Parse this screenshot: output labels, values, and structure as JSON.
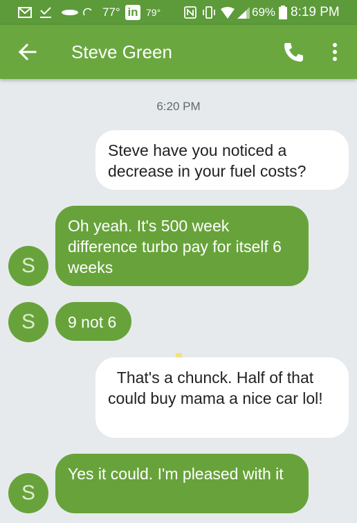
{
  "status_bar": {
    "temp1": "77°",
    "temp2": "79°",
    "linkedin": "in",
    "battery": "69%",
    "time": "8:19 PM"
  },
  "header": {
    "title": "Steve Green",
    "back_icon": "arrow-left-icon",
    "call_icon": "phone-icon",
    "menu_icon": "more-vert-icon"
  },
  "thread": {
    "timestamp": "6:20 PM",
    "messages": [
      {
        "direction": "outgoing",
        "text": "Steve have you noticed a decrease in your fuel costs?"
      },
      {
        "direction": "incoming",
        "avatar": "S",
        "text": "Oh yeah.  It's 500 week difference turbo pay for itself 6 weeks"
      },
      {
        "direction": "incoming",
        "avatar": "S",
        "text": "9 not 6"
      },
      {
        "direction": "outgoing",
        "text": "  That's a chunck. Half of that could buy mama a nice car lol!"
      },
      {
        "direction": "incoming",
        "avatar": "S",
        "text": "Yes it could. I'm pleased with it"
      }
    ]
  },
  "colors": {
    "app_bar": "#6aa83f",
    "status_bar": "#5c9a3a",
    "incoming_bubble": "#67a33a",
    "outgoing_bubble": "#ffffff",
    "background": "#e6eaed"
  }
}
